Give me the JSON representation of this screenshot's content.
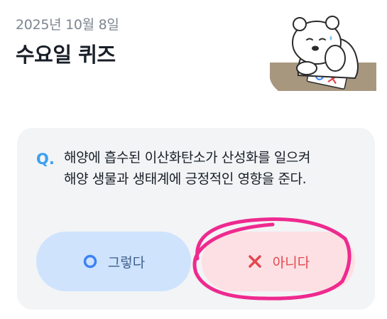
{
  "header": {
    "date": "2025년 10월 8일",
    "title": "수요일 퀴즈"
  },
  "illustration": {
    "name": "bear-thinking-illustration",
    "card_text": "OX"
  },
  "quiz": {
    "q_mark": "Q.",
    "question_lines": [
      "해양에 흡수된 이산화탄소가 산성화를 일으켜",
      "해양 생물과 생태계에 긍정적인 영향을 준다."
    ],
    "options": [
      {
        "icon": "circle-icon",
        "label": "그렇다"
      },
      {
        "icon": "x-icon",
        "label": "아니다"
      }
    ]
  },
  "colors": {
    "q_accent": "#3aa0f0",
    "yes_bg": "#cfe3fd",
    "yes_icon": "#3b82f6",
    "no_bg": "#fde0e3",
    "no_icon": "#e2474f",
    "annotation": "#ee2a8f"
  }
}
